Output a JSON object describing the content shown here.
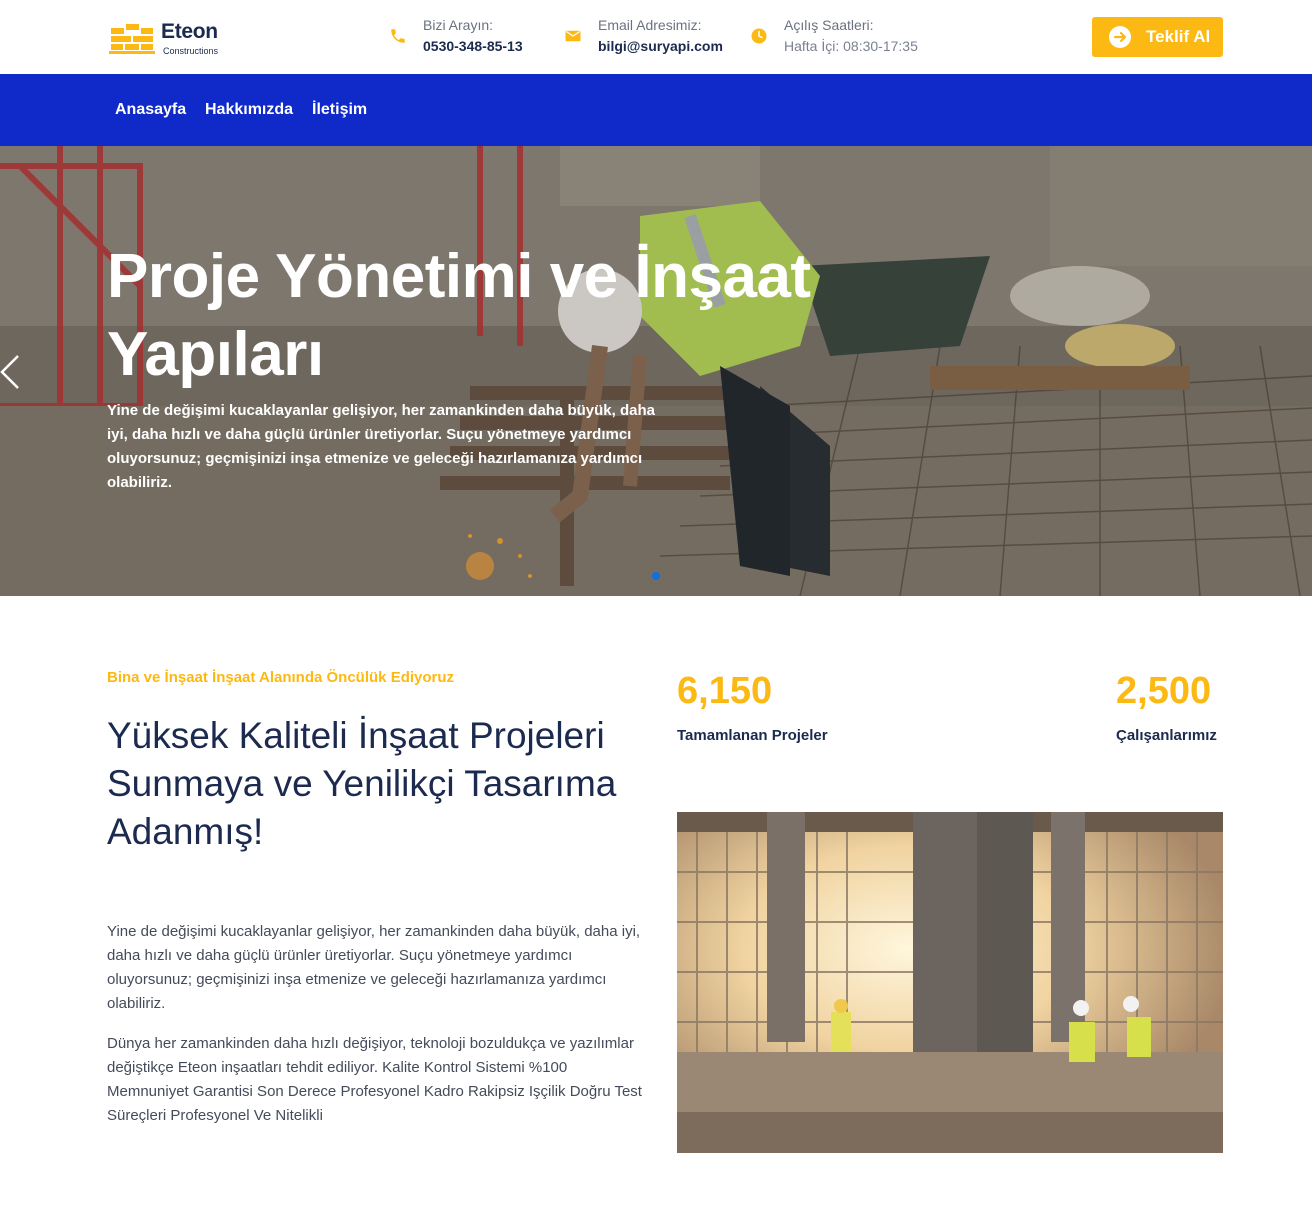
{
  "brand": {
    "name": "Eteon",
    "tagline": "Constructions",
    "accent": "#fdb913",
    "nav_color": "#0f2ac9"
  },
  "header": {
    "phone": {
      "label": "Bizi Arayın:",
      "value": "0530-348-85-13",
      "icon": "phone-icon"
    },
    "email": {
      "label": "Email Adresimiz:",
      "value": "bilgi@suryapi.com",
      "icon": "envelope-icon"
    },
    "hours": {
      "label": "Açılış Saatleri:",
      "value": "Hafta İçi: 08:30-17:35",
      "icon": "clock-icon"
    },
    "cta_label": "Teklif Al"
  },
  "nav": {
    "items": [
      "Anasayfa",
      "Hakkımızda",
      "İletişim"
    ]
  },
  "hero": {
    "title": "Proje Yönetimi ve İnşaat Yapıları",
    "text": "Yine de değişimi kucaklayanlar gelişiyor, her zamankinden daha büyük, daha iyi, daha hızlı ve daha güçlü ürünler üretiyorlar. Suçu yönetmeye yardımcı oluyorsunuz; geçmişinizi inşa etmenize ve geleceği hazırlamanıza yardımcı olabiliriz."
  },
  "about": {
    "eyebrow": "Bina ve İnşaat İnşaat Alanında Öncülük Ediyoruz",
    "title": "Yüksek Kaliteli İnşaat Projeleri Sunmaya ve Yenilikçi Tasarıma Adanmış!",
    "p1": "Yine de değişimi kucaklayanlar gelişiyor, her zamankinden daha büyük, daha iyi, daha hızlı ve daha güçlü ürünler üretiyorlar. Suçu yönetmeye yardımcı oluyorsunuz; geçmişinizi inşa etmenize ve geleceği hazırlamanıza yardımcı olabiliriz.",
    "p2": "Dünya her zamankinden daha hızlı değişiyor, teknoloji bozuldukça ve yazılımlar değiştikçe Eteon inşaatları tehdit ediliyor. Kalite Kontrol Sistemi %100 Memnuniyet Garantisi Son Derece Profesyonel Kadro Rakipsiz Işçilik Doğru Test Süreçleri Profesyonel Ve Nitelikli"
  },
  "stats": [
    {
      "value": "6,150",
      "label": "Tamamlanan Projeler"
    },
    {
      "value": "2,500",
      "label": "Çalışanlarımız"
    }
  ]
}
